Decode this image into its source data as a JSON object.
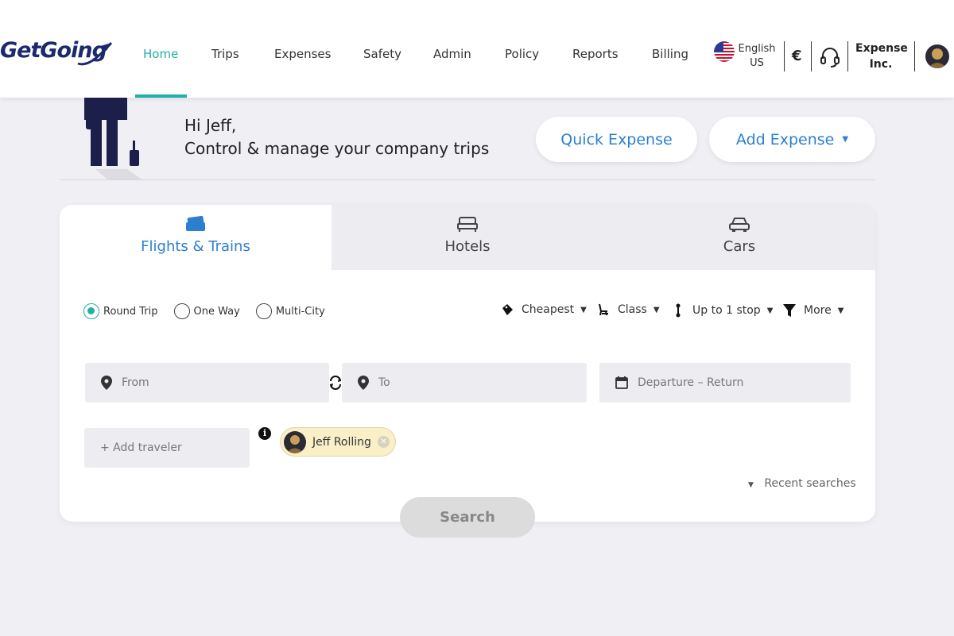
{
  "brand": {
    "name": "GetGoing",
    "primary_color": "#21b0a6",
    "accent_color": "#2b7fd0",
    "logo_color": "#1a2a6c"
  },
  "nav": {
    "items": [
      {
        "label": "Home",
        "active": true
      },
      {
        "label": "Trips"
      },
      {
        "label": "Expenses"
      },
      {
        "label": "Safety"
      },
      {
        "label": "Admin"
      },
      {
        "label": "Policy"
      },
      {
        "label": "Reports"
      },
      {
        "label": "Billing"
      }
    ]
  },
  "header": {
    "language_line1": "English",
    "language_line2": "US",
    "currency": "€",
    "company_line1": "Expense",
    "company_line2": "Inc."
  },
  "greeting": {
    "line1": "Hi Jeff,",
    "line2": "Control & manage your company trips"
  },
  "actions": {
    "quick_expense": "Quick Expense",
    "add_expense": "Add Expense"
  },
  "tabs": [
    {
      "label": "Flights & Trains",
      "icon": "ticket-icon",
      "active": true
    },
    {
      "label": "Hotels",
      "icon": "bed-icon"
    },
    {
      "label": "Cars",
      "icon": "car-icon"
    }
  ],
  "trip_types": [
    {
      "label": "Round Trip",
      "selected": true
    },
    {
      "label": "One Way"
    },
    {
      "label": "Multi-City"
    }
  ],
  "filters": {
    "sort": "Cheapest",
    "class": "Class",
    "stops": "Up to 1 stop",
    "more": "More"
  },
  "fields": {
    "from_placeholder": "From",
    "to_placeholder": "To",
    "dates_placeholder": "Departure – Return"
  },
  "travelers": {
    "add_label": "+ Add traveler",
    "info": "i",
    "selected": [
      {
        "name": "Jeff Rolling"
      }
    ]
  },
  "recent_searches": "Recent searches",
  "search_button": "Search"
}
